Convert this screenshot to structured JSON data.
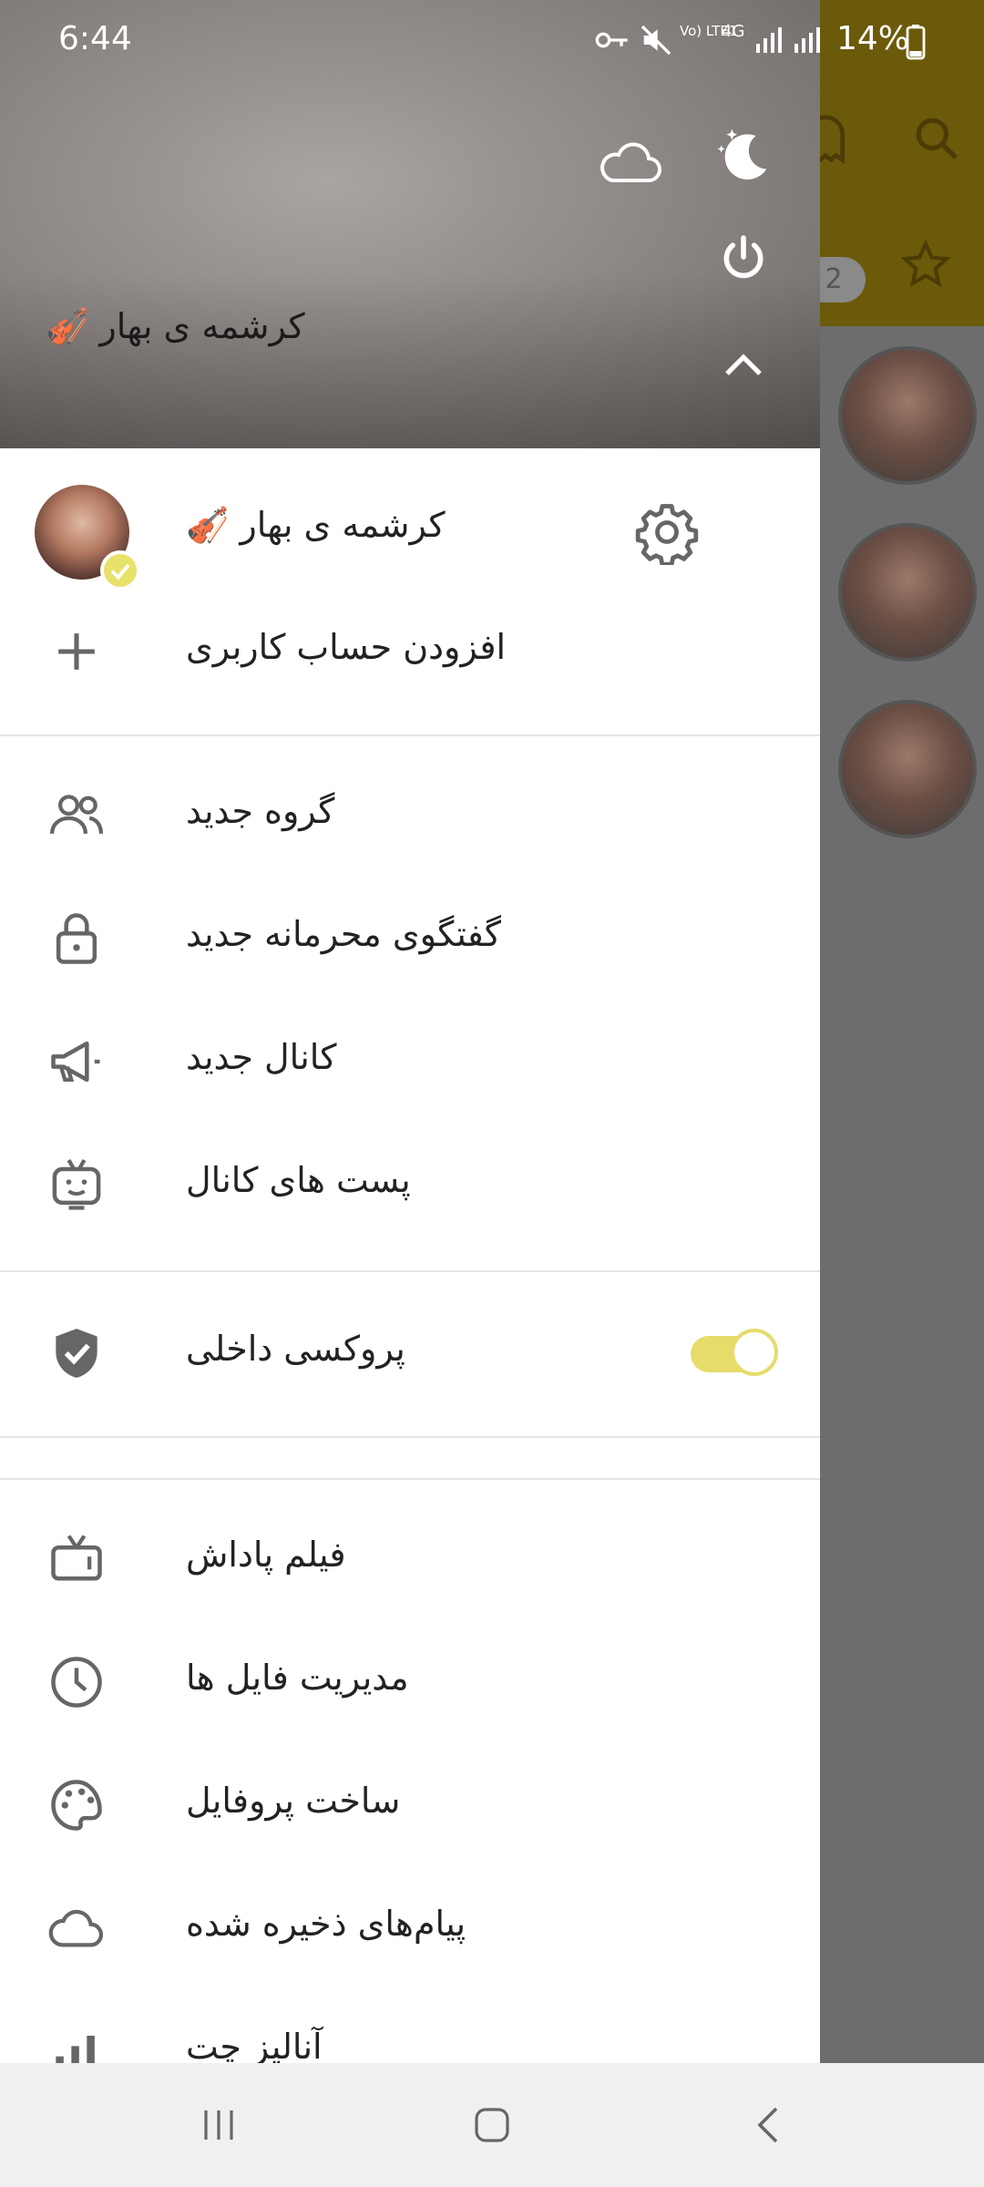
{
  "status_bar": {
    "time": "6:44",
    "battery": "14%",
    "network_left": "Vo) LTE1",
    "network_right": "4G"
  },
  "drawer": {
    "header": {
      "name": "کرشمه ی بهار 🎻"
    },
    "account": {
      "name": "کرشمه ی بهار 🎻",
      "add_account": "افزودن حساب کاربری"
    },
    "menu": {
      "new_group": "گروه جدید",
      "new_secret_chat": "گفتگوی محرمانه جدید",
      "new_channel": "کانال جدید",
      "channel_posts": "پست های کانال",
      "internal_proxy": "پروکسی داخلی",
      "reward_video": "فیلم پاداش",
      "file_manager": "مدیریت فایل ها",
      "profile_maker": "ساخت پروفایل",
      "saved_messages": "پیام‌های ذخیره شده",
      "analyzer": "آنالیز چت"
    },
    "proxy_enabled": true
  },
  "background_app": {
    "badge_count": "2"
  },
  "colors": {
    "accent": "#e6dc6a",
    "topbar": "#6b5a0a",
    "nav_bar": "#f0f0f0"
  },
  "icons": [
    "moon-stars-icon",
    "cloud-icon",
    "power-icon",
    "chevron-up-icon",
    "gear-icon",
    "plus-icon",
    "group-icon",
    "lock-icon",
    "megaphone-icon",
    "robot-tv-icon",
    "shield-check-icon",
    "tv-icon",
    "clock-icon",
    "palette-icon",
    "cloud-outline-icon",
    "bar-chart-icon",
    "ghost-icon",
    "search-icon",
    "star-icon"
  ]
}
